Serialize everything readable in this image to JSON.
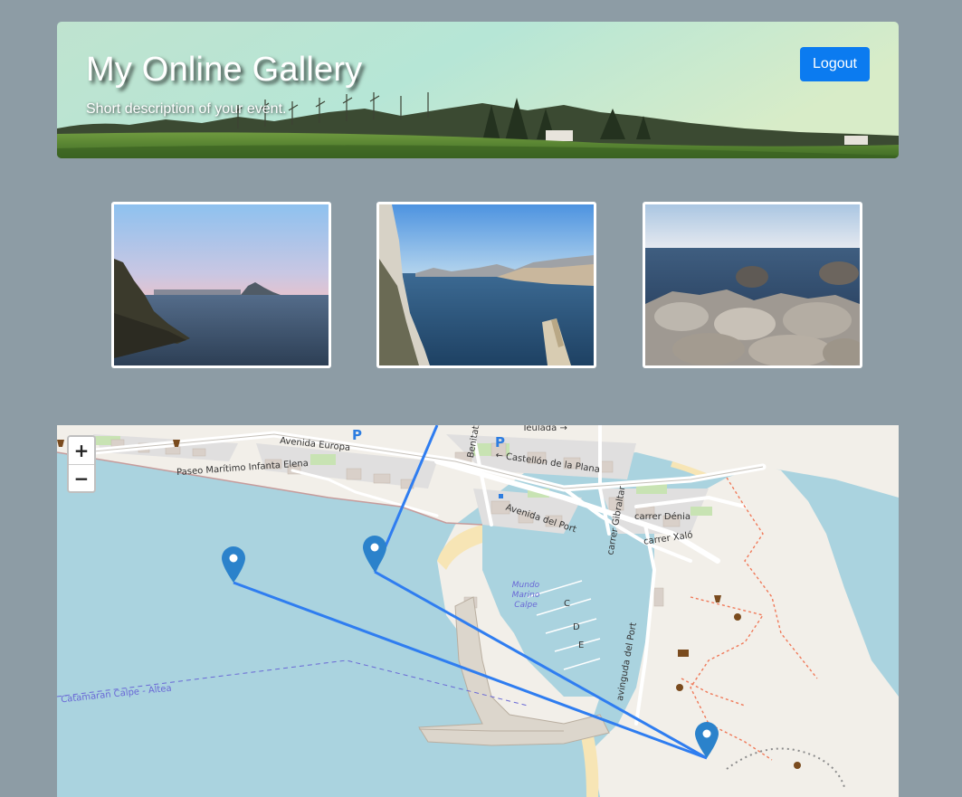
{
  "header": {
    "title": "My Online Gallery",
    "subtitle": "Short description of your event.",
    "logout_label": "Logout"
  },
  "gallery": {
    "photos": [
      {
        "name": "photo-coast-penyal"
      },
      {
        "name": "photo-bay-cliff"
      },
      {
        "name": "photo-rocks-sea"
      }
    ]
  },
  "map": {
    "zoom_in_label": "+",
    "zoom_out_label": "−",
    "labels": {
      "teulada": "Teulada →",
      "avenida_europa": "Avenida Europa",
      "paseo_maritimo": "Paseo Marítimo Infanta Elena",
      "benitatx": "Benitatx",
      "castellon": "← Castellón de la Plana",
      "avenida_port": "Avenida del Port",
      "carrer_gibraltar": "carrer Gibraltar",
      "carrer_denia": "carrer Dénia",
      "carrer_xalo": "carrer Xaló",
      "avinguda_port": "avinguda del Port",
      "mundo_marino": "Mundo Marino Calpe",
      "catamaran": "Catamaran Calpe - Altea",
      "pier_c": "C",
      "pier_d": "D",
      "pier_e": "E",
      "parking": "P"
    },
    "route_color": "#2f7df0",
    "marker_color": "#2b82cb"
  }
}
